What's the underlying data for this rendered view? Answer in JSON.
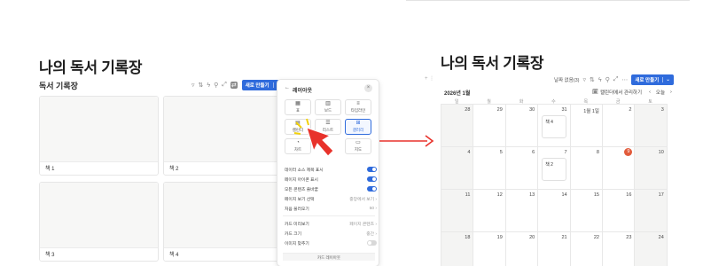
{
  "left": {
    "page_title": "나의 독서 기록장",
    "db_title": "독서 기록장",
    "toolbar_icons": [
      "filter-icon",
      "sort-icon",
      "automation-icon",
      "search-icon",
      "expand-icon",
      "link-icon"
    ],
    "new_button": "새로 만들기",
    "cards": [
      {
        "label": "책 1"
      },
      {
        "label": "책 2"
      },
      {
        "label": "책 3"
      },
      {
        "label": "책 4"
      }
    ]
  },
  "panel": {
    "title": "레이아웃",
    "back_icon": "←",
    "close_icon": "×",
    "layouts": [
      {
        "label": "표",
        "icon": "▦"
      },
      {
        "label": "보드",
        "icon": "▥"
      },
      {
        "label": "타임라인",
        "icon": "≡"
      },
      {
        "label": "캘린더",
        "icon": "▤"
      },
      {
        "label": "리스트",
        "icon": "☰"
      },
      {
        "label": "갤러리",
        "icon": "⊞"
      },
      {
        "label": "차트",
        "icon": "◔"
      },
      {
        "label": "지도",
        "icon": "▭"
      }
    ],
    "rows": [
      {
        "label": "데이터 소스 제목 표시",
        "type": "toggle",
        "on": true
      },
      {
        "label": "페이지 아이콘 표시",
        "type": "toggle",
        "on": true
      },
      {
        "label": "모든 콘텐츠 줄바꿈",
        "type": "toggle",
        "on": true
      },
      {
        "label": "페이지 보기 선택",
        "type": "value",
        "value": "중앙에서 보기 ›"
      },
      {
        "label": "처음 불러오기",
        "type": "value",
        "value": "50 ›"
      },
      {
        "label": "카드 미리보기",
        "type": "value",
        "value": "페이지 콘텐츠 ›"
      },
      {
        "label": "카드 크기",
        "type": "value",
        "value": "중간 ›"
      },
      {
        "label": "이미지 맞추기",
        "type": "toggle",
        "on": false
      }
    ],
    "footer_button": "카드 레이아웃"
  },
  "right": {
    "page_title": "나의 독서 기록장",
    "toolbar_text": "날짜 없음(3)",
    "new_button": "새로 만들기",
    "month": "2026년 1월",
    "manage_link": "캘린더에서 관리하기",
    "today_button": "오늘",
    "weekdays": [
      "일",
      "월",
      "화",
      "수",
      "목",
      "금",
      "토"
    ],
    "weeks": [
      [
        "28",
        "29",
        "30",
        "31",
        "1월 1일",
        "2",
        "3"
      ],
      [
        "4",
        "5",
        "6",
        "7",
        "8",
        "9",
        "10"
      ],
      [
        "11",
        "12",
        "13",
        "14",
        "15",
        "16",
        "17"
      ],
      [
        "18",
        "19",
        "20",
        "21",
        "22",
        "23",
        "24"
      ]
    ],
    "today": "9",
    "events": [
      {
        "label": "책 4"
      },
      {
        "label": "책 2"
      }
    ]
  },
  "colors": {
    "accent": "#2f6bdc",
    "arrow": "#e8322b",
    "today": "#e25b3b"
  }
}
